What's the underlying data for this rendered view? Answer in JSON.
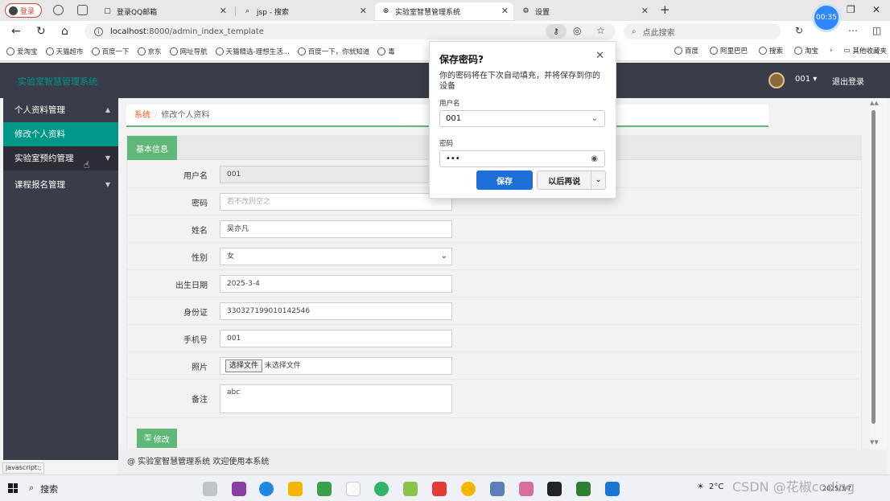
{
  "browser": {
    "profile_label": "登录",
    "tabs": [
      {
        "label": "登录QQ邮箱",
        "active": false
      },
      {
        "label": "jsp - 搜索",
        "active": false
      },
      {
        "label": "实验室智慧管理系统",
        "active": true
      },
      {
        "label": "设置",
        "active": false
      }
    ],
    "timer": "00:35",
    "url_host": "localhost",
    "url_rest": ":8000/admin_index_template",
    "search_placeholder": "点此搜索",
    "favorites": [
      "爱淘宝",
      "天猫超市",
      "百度一下",
      "京东",
      "网址导航",
      "天猫精选-理想生活...",
      "百度一下，你就知道",
      "毒"
    ],
    "favorites_right": [
      "百度",
      "阿里巴巴",
      "搜索",
      "淘宝"
    ],
    "other_favorites": "其他收藏夹",
    "status_url": "javascript:;"
  },
  "app": {
    "title": "实验室智慧管理系统",
    "user": "001 ▾",
    "logout": "退出登录"
  },
  "sidebar": {
    "items": [
      {
        "label": "个人资料管理",
        "arrow": "▲"
      },
      {
        "label": "修改个人资料"
      },
      {
        "label": "实验室预约管理",
        "arrow": "▼"
      },
      {
        "label": "课程报名管理",
        "arrow": "▼"
      }
    ]
  },
  "breadcrumb": {
    "root": "系统",
    "sep": "/",
    "current": "修改个人资料"
  },
  "form": {
    "tab": "基本信息",
    "username_label": "用户名",
    "username_value": "001",
    "password_label": "密码",
    "password_placeholder": "若不改则空之",
    "name_label": "姓名",
    "name_value": "吴亦凡",
    "gender_label": "性别",
    "gender_value": "女",
    "birth_label": "出生日期",
    "birth_value": "2025-3-4",
    "idcard_label": "身份证",
    "idcard_value": "330327199010142546",
    "phone_label": "手机号",
    "phone_value": "001",
    "photo_label": "照片",
    "photo_button": "选择文件",
    "photo_status": "未选择文件",
    "note_label": "备注",
    "note_value": "abc",
    "submit": "修改"
  },
  "footer": "@ 实验室智慧管理系统 欢迎使用本系统",
  "password_popup": {
    "title": "保存密码?",
    "desc": "你的密码将在下次自动填充，并将保存到你的设备",
    "username_label": "用户名",
    "username_value": "001",
    "password_label": "密码",
    "password_value": "•••",
    "save": "保存",
    "later": "以后再说"
  },
  "taskbar": {
    "search": "搜索",
    "weather": "2°C",
    "date": "2025/3/7"
  },
  "watermark": "CSDN @花椒coding",
  "colors": {
    "header": "#393d49",
    "accent": "#009688",
    "green": "#5fb878",
    "save_blue": "#1f6fd9"
  }
}
